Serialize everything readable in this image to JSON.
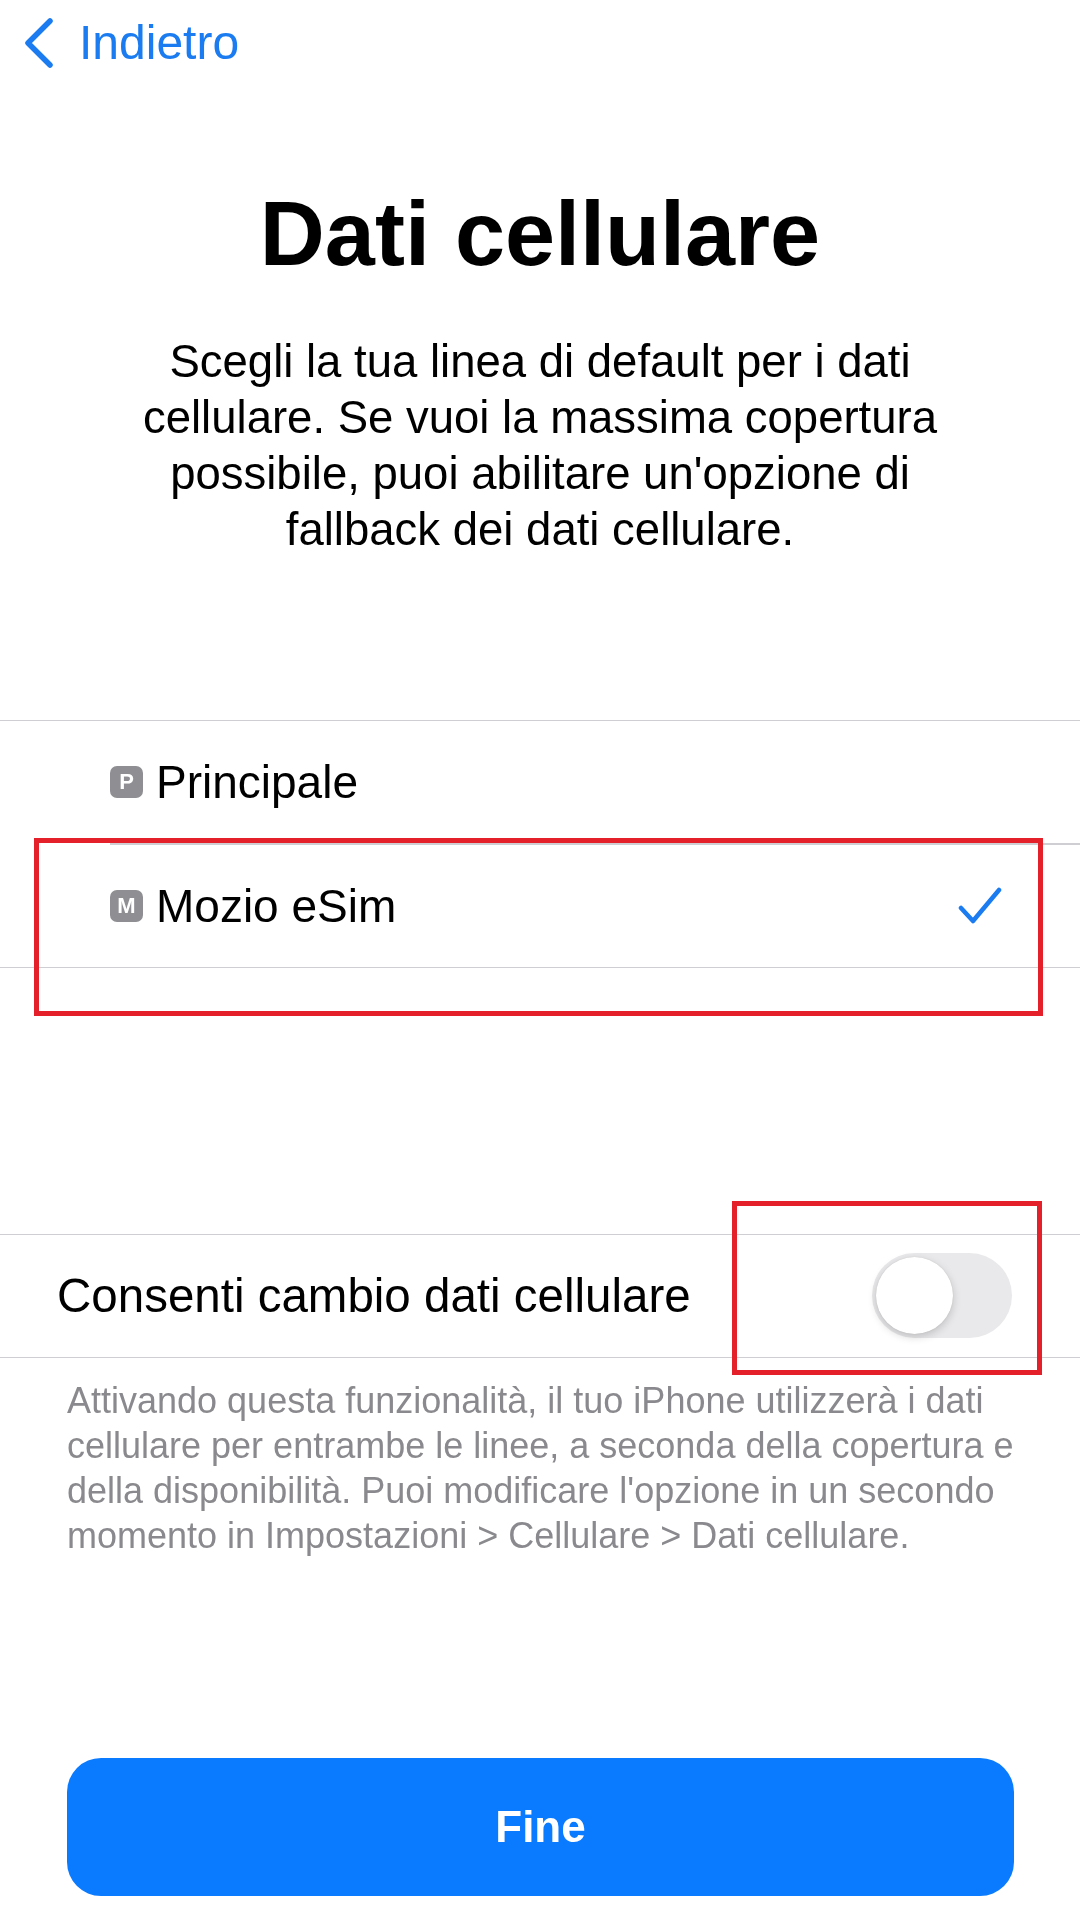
{
  "nav": {
    "back_label": "Indietro"
  },
  "title": "Dati cellulare",
  "description": "Scegli la tua linea di default per i dati cellulare. Se vuoi la massima copertura possibile, puoi abilitare un'opzione di fallback dei dati cellulare.",
  "lines": [
    {
      "badge": "P",
      "name": "Principale",
      "selected": false,
      "highlighted": false
    },
    {
      "badge": "M",
      "name": "Mozio eSim",
      "selected": true,
      "highlighted": true
    }
  ],
  "switch_row": {
    "label": "Consenti cambio dati cellulare",
    "on": false,
    "highlighted": true
  },
  "footnote": "Attivando questa funzionalità, il tuo iPhone utilizzerà i dati cellulare per entrambe le linee, a seconda della copertura e della disponibilità. Puoi modificare l'opzione in un secondo momento in Impostazioni > Cellulare > Dati cellulare.",
  "button": {
    "label": "Fine"
  }
}
